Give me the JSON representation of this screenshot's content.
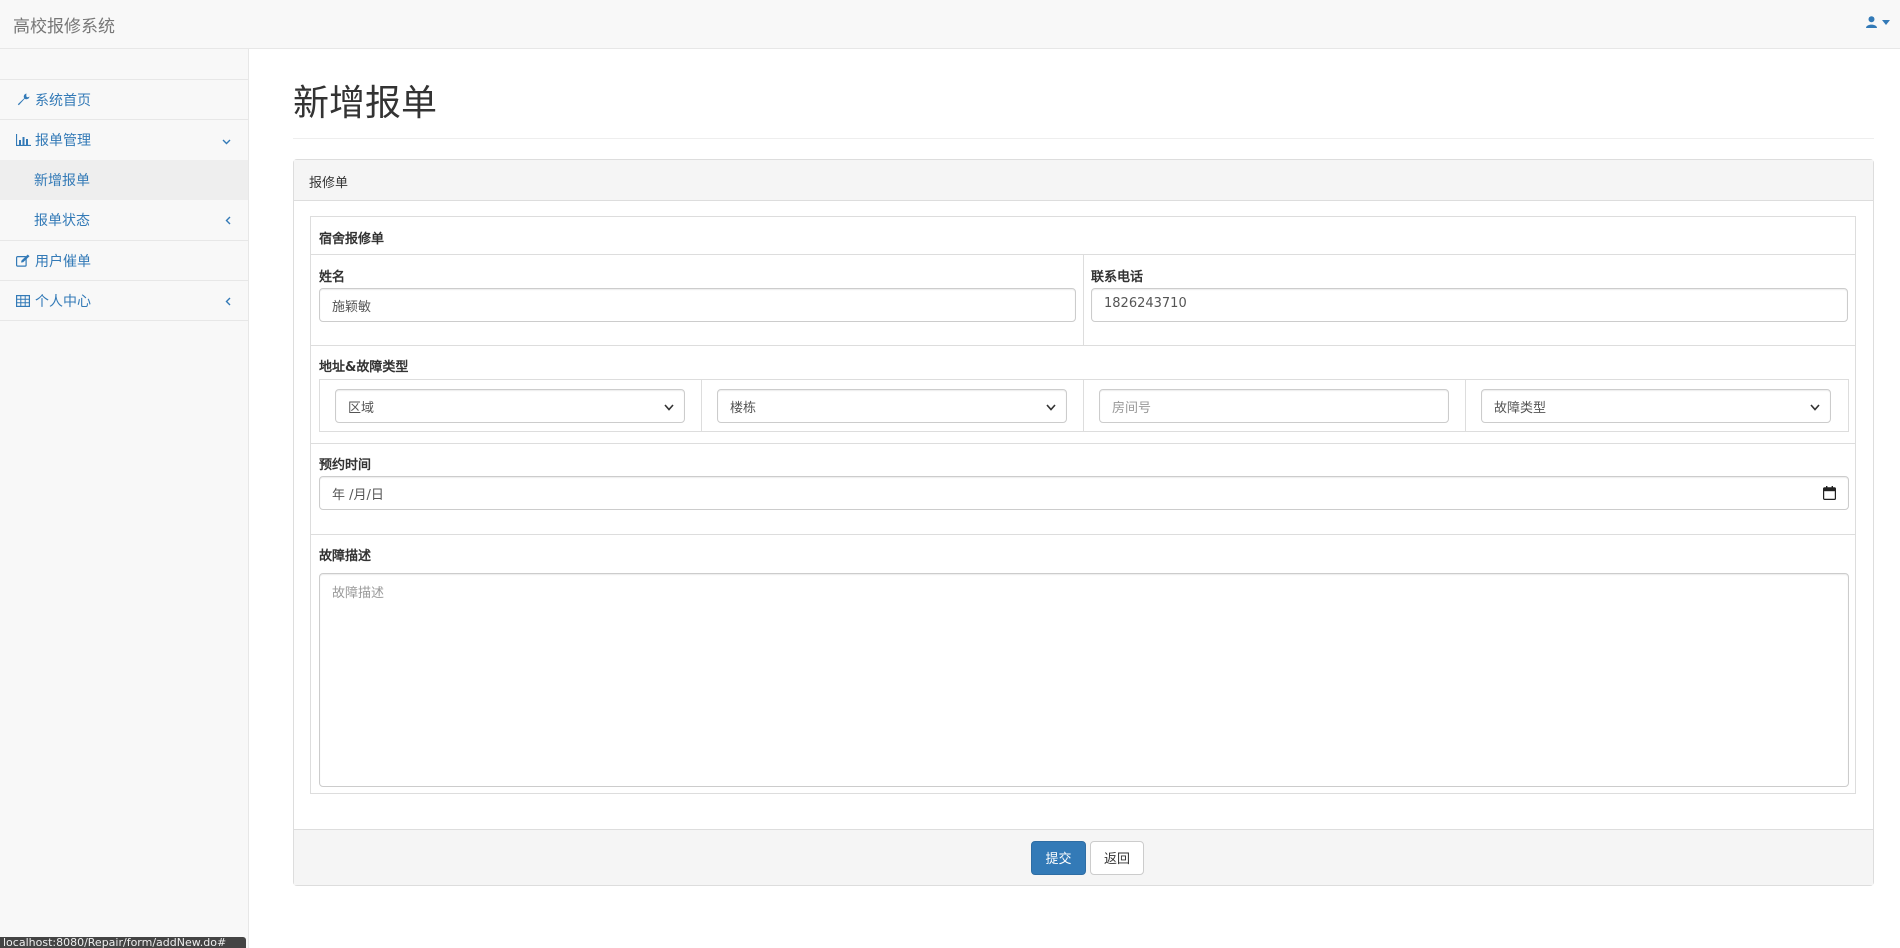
{
  "navbar": {
    "brand": "高校报修系统",
    "user_icon": "user-icon"
  },
  "sidebar": {
    "items": [
      {
        "label": "系统首页",
        "icon": "wrench-icon"
      },
      {
        "label": "报单管理",
        "icon": "bar-chart-icon",
        "expanded": true,
        "children": [
          {
            "label": "新增报单",
            "active": true
          },
          {
            "label": "报单状态"
          }
        ]
      },
      {
        "label": "用户催单",
        "icon": "edit-icon"
      },
      {
        "label": "个人中心",
        "icon": "table-icon"
      }
    ]
  },
  "page": {
    "title": "新增报单"
  },
  "panel": {
    "heading": "报修单",
    "form_title": "宿舍报修单",
    "name": {
      "label": "姓名",
      "value": "施颖敏"
    },
    "phone": {
      "label": "联系电话",
      "value": "1826243710"
    },
    "address": {
      "label": "地址&故障类型",
      "area": "区域",
      "building": "楼栋",
      "room_placeholder": "房间号",
      "fault_type": "故障类型"
    },
    "appointment": {
      "label": "预约时间",
      "value": "年 /月/日"
    },
    "description": {
      "label": "故障描述",
      "placeholder": "故障描述"
    },
    "submit_label": "提交",
    "back_label": "返回"
  },
  "status_bar": {
    "url": "localhost:8080/Repair/form/addNew.do#"
  }
}
